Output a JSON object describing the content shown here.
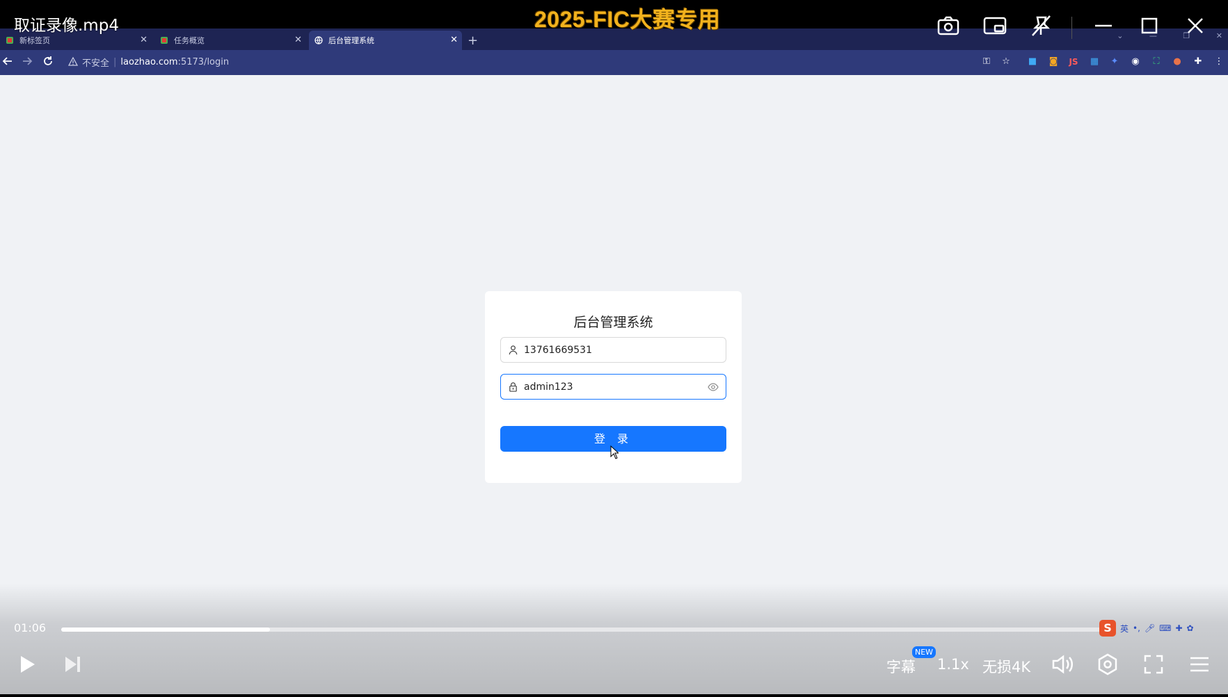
{
  "player": {
    "title": "取证录像.mp4",
    "watermark": "2025-FIC大赛专用",
    "elapsed": "01:06",
    "progress_fraction": 0.2,
    "subtitle_label": "字幕",
    "subtitle_badge": "NEW",
    "speed": "1.1x",
    "quality": "无损4K",
    "top_icons": [
      "camera-icon",
      "picture-in-picture-icon",
      "pin-off-icon",
      "minimize-icon",
      "maximize-icon",
      "close-icon"
    ],
    "bottom_icons": [
      "play-icon",
      "next-icon",
      "volume-icon",
      "settings-icon",
      "fullscreen-icon",
      "playlist-icon"
    ]
  },
  "browser": {
    "tabs": [
      {
        "label": "新标签页",
        "active": false
      },
      {
        "label": "任务概览",
        "active": false
      },
      {
        "label": "后台管理系统",
        "active": true
      }
    ],
    "security_text": "不安全",
    "url_host": "laozhao.com",
    "url_path": ":5173/login",
    "extension_js": "JS"
  },
  "login": {
    "title": "后台管理系统",
    "username_value": "13761669531",
    "password_value": "admin123",
    "submit_label": "登 录"
  },
  "ime": {
    "logo": "S",
    "lang": "英"
  },
  "colors": {
    "primary": "#1677ff",
    "page_bg": "#f0f2f5",
    "chrome_bg": "#1e2453",
    "toolbar_bg": "#2f3a7a",
    "watermark": "#f2b21d"
  }
}
